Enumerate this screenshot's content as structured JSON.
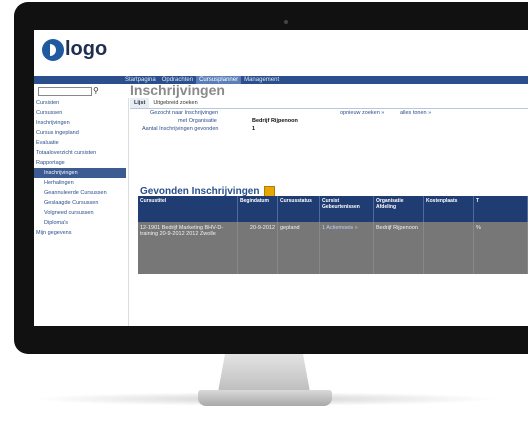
{
  "logo": {
    "text": "logo"
  },
  "nav": [
    {
      "label": "Startpagina",
      "active": false
    },
    {
      "label": "Opdrachten",
      "active": false
    },
    {
      "label": "Cursusplanner",
      "active": true
    },
    {
      "label": "Management",
      "active": false
    }
  ],
  "page_title": "Inschrijvingen",
  "sidebar": [
    {
      "label": "Cursisten"
    },
    {
      "label": "Cursussen"
    },
    {
      "label": "Inschrijvingen"
    },
    {
      "label": "Cursus ingepland"
    },
    {
      "label": "Evaluatie"
    },
    {
      "label": "Totaaloverzicht cursisten"
    },
    {
      "label": "Rapportage"
    },
    {
      "label": "Inschrijvingen",
      "sub": true,
      "active": true
    },
    {
      "label": "Herhalingen",
      "sub": true
    },
    {
      "label": "Geannuleerde Cursussen",
      "sub": true
    },
    {
      "label": "Geslaagde Cursussen",
      "sub": true
    },
    {
      "label": "Volgneed cursussen",
      "sub": true
    },
    {
      "label": "Diploma's",
      "sub": true
    },
    {
      "label": "Mijn gegevens"
    }
  ],
  "tabs": [
    {
      "label": "Lijst",
      "active": true
    },
    {
      "label": "Uitgebreid zoeken",
      "active": false
    }
  ],
  "filter": {
    "heading": "Gezocht naar Inschrijvingen",
    "org_label": "met Organisatie",
    "org_value": "Bedrijf Rijpenoon",
    "count_label": "Aantal Inschrijvingen gevonden",
    "count_value": "1",
    "link1": "opnieuw zoeken »",
    "link2": "alles tonen »"
  },
  "results_title": "Gevonden Inschrijvingen",
  "grid": {
    "headers": [
      "Cursustitel",
      "Begindatum",
      "Cursusstatus",
      "Cursist Gebeurtenissen",
      "Organisatie Afdeling",
      "Kostenplaats",
      "T"
    ],
    "row": [
      "12-1901 Bedrijf Marketing BHV-D-training 20-9-2012 2012 Zwolle",
      "20-9-2012",
      "gepland",
      "1 Actiemoeis »",
      "Bedrijf Rijpenoon",
      "",
      "%"
    ]
  }
}
